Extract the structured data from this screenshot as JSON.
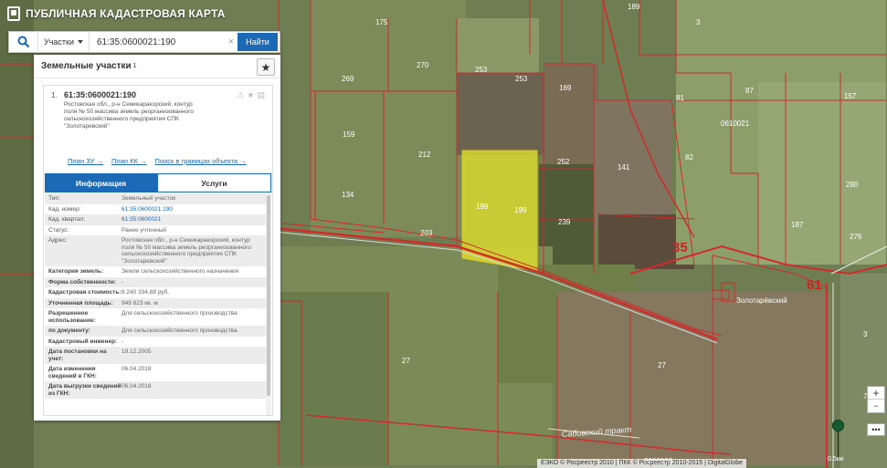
{
  "app": {
    "title": "ПУБЛИЧНАЯ КАДАСТРОВАЯ КАРТА"
  },
  "search": {
    "type_label": "Участки",
    "query": "61:35:0600021:190",
    "button_label": "Найти"
  },
  "panel": {
    "title": "Земельные участки",
    "count": "1",
    "result": {
      "index": "1.",
      "cad_number": "61:35:0600021:190",
      "address": "Ростовская обл., р-н Семикаракорский, контур поля № 50 массива земель реорганизованного сельскохозяйственного предприятия СПК \"Золотаревский\"",
      "links": [
        "План ЗУ →",
        "План КК →",
        "Поиск в границах объекта →"
      ]
    },
    "tabs": [
      "Информация",
      "Услуги"
    ],
    "rows": [
      {
        "k": "Тип:",
        "v": "Земельный участок",
        "bold": false,
        "link": false
      },
      {
        "k": "Кад. номер:",
        "v": "61:35:0600021:190",
        "bold": false,
        "link": true
      },
      {
        "k": "Кад. квартал:",
        "v": "61:35:0600021",
        "bold": false,
        "link": true
      },
      {
        "k": "Статус:",
        "v": "Ранее учтенный",
        "bold": false,
        "link": false
      },
      {
        "k": "Адрес:",
        "v": "Ростовская обл., р-н Семикаракорский, контур поля № 50 массива земель реорганизованного сельскохозяйственного предприятия СПК \"Золотаревский\"",
        "bold": false,
        "link": false
      },
      {
        "k": "Категория земель:",
        "v": "Земли сельскохозяйственного назначения",
        "bold": true,
        "link": false
      },
      {
        "k": "Форма собственности:",
        "v": "-",
        "bold": true,
        "link": false
      },
      {
        "k": "Кадастровая стоимость:",
        "v": "6 240 334,88 руб.",
        "bold": true,
        "link": false
      },
      {
        "k": "Уточненная площадь:",
        "v": "949 823 кв. м",
        "bold": true,
        "link": false
      },
      {
        "k": "Разрешенное использование:",
        "v": "Для сельскохозяйственного производства",
        "bold": true,
        "link": false
      },
      {
        "k": "по документу:",
        "v": "Для сельскохозяйственного производства",
        "bold": true,
        "link": false
      },
      {
        "k": "Кадастровый инженер:",
        "v": "-",
        "bold": true,
        "link": false
      },
      {
        "k": "Дата постановки на учет:",
        "v": "19.12.2005",
        "bold": true,
        "link": false
      },
      {
        "k": "Дата изменения сведений в ГКН:",
        "v": "06.04.2018",
        "bold": true,
        "link": false
      },
      {
        "k": "Дата выгрузки сведений из ГКН:",
        "v": "06.04.2018",
        "bold": true,
        "link": false
      }
    ]
  },
  "map": {
    "parcel_labels": [
      "175",
      "270",
      "253",
      "253",
      "169",
      "189",
      "3",
      "269",
      "81",
      "87",
      "157",
      "159",
      "0610021",
      "212",
      "252",
      "141",
      "82",
      "134",
      "199",
      "199",
      "239",
      "187",
      "280",
      "203",
      "276",
      "35",
      "61",
      "Золотарёвский",
      "27",
      "27",
      "Сабовский тракт",
      "0600000",
      "3",
      "7"
    ],
    "highlight_color": "#e3e22b"
  },
  "zoom": {
    "in": "+",
    "out": "−",
    "dots": "•••"
  },
  "footer": {
    "attribution": "ЕЭКО © Росреестр 2010 | ПКК © Росреестр 2010-2015 | DigitalGlobe",
    "scale": "0.5км"
  }
}
